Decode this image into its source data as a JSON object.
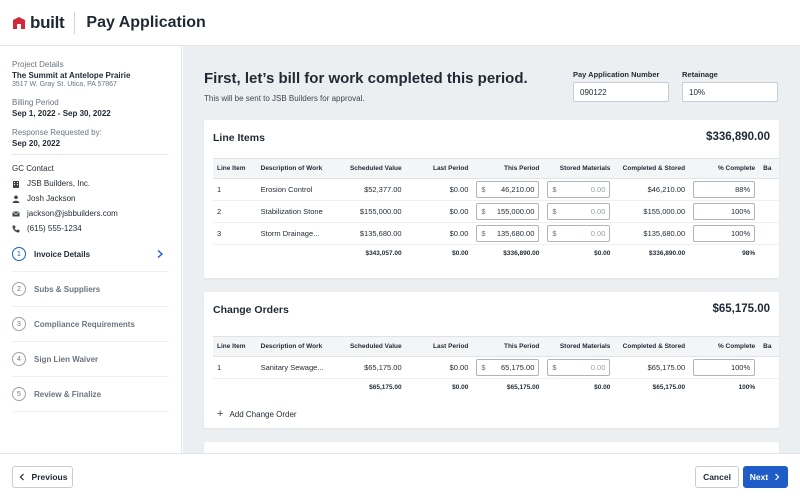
{
  "header": {
    "logo_text": "built",
    "title": "Pay Application"
  },
  "sidebar": {
    "project_label": "Project Details",
    "project_name": "The Summit at Antelope Prairie",
    "project_address": "3517 W. Gray St. Utica, PA 57867",
    "billing_label": "Billing Period",
    "billing_value": "Sep 1, 2022 - Sep 30, 2022",
    "response_label": "Response Requested by:",
    "response_value": "Sep 20, 2022",
    "gc_label": "GC Contact",
    "gc": {
      "company": "JSB Builders, Inc.",
      "name": "Josh Jackson",
      "email": "jackson@jsbbuilders.com",
      "phone": "(615) 555-1234"
    },
    "steps": [
      {
        "num": "1",
        "label": "Invoice Details"
      },
      {
        "num": "2",
        "label": "Subs & Suppliers"
      },
      {
        "num": "3",
        "label": "Compliance Requirements"
      },
      {
        "num": "4",
        "label": "Sign Lien Waiver"
      },
      {
        "num": "5",
        "label": "Review & Finalize"
      }
    ]
  },
  "main": {
    "headline": "First, let’s bill for work completed this period.",
    "subline": "This will be sent to JSB Builders for approval.",
    "pay_app_label": "Pay Application Number",
    "pay_app_value": "090122",
    "retainage_label": "Retainage",
    "retainage_value": "10%"
  },
  "columns": [
    "Line Item",
    "Description of Work",
    "Scheduled Value",
    "Last Period",
    "This Period",
    "Stored Materials",
    "Completed & Stored",
    "% Complete",
    "Ba"
  ],
  "line_items": {
    "title": "Line Items",
    "total": "$336,890.00",
    "rows": [
      {
        "item": "1",
        "desc": "Erosion Control",
        "scheduled": "$52,377.00",
        "last": "$0.00",
        "this_cur": "$",
        "this": "46,210.00",
        "stored_cur": "$",
        "stored": "0.00",
        "completed": "$46,210.00",
        "pct": "88%"
      },
      {
        "item": "2",
        "desc": "Stabilization Stone",
        "scheduled": "$155,000.00",
        "last": "$0.00",
        "this_cur": "$",
        "this": "155,000.00",
        "stored_cur": "$",
        "stored": "0.00",
        "completed": "$155,000.00",
        "pct": "100%"
      },
      {
        "item": "3",
        "desc": "Storm Drainage...",
        "scheduled": "$135,680.00",
        "last": "$0.00",
        "this_cur": "$",
        "this": "135,680.00",
        "stored_cur": "$",
        "stored": "0.00",
        "completed": "$135,680.00",
        "pct": "100%"
      }
    ],
    "totals": {
      "scheduled": "$343,057.00",
      "last": "$0.00",
      "this": "$336,890.00",
      "stored": "$0.00",
      "completed": "$336,890.00",
      "pct": "98%"
    }
  },
  "change_orders": {
    "title": "Change Orders",
    "total": "$65,175.00",
    "rows": [
      {
        "item": "1",
        "desc": "Sanitary Sewage...",
        "scheduled": "$65,175.00",
        "last": "$0.00",
        "this_cur": "$",
        "this": "65,175.00",
        "stored_cur": "$",
        "stored": "0.00",
        "completed": "$65,175.00",
        "pct": "100%"
      }
    ],
    "totals": {
      "scheduled": "$65,175.00",
      "last": "$0.00",
      "this": "$65,175.00",
      "stored": "$0.00",
      "completed": "$65,175.00",
      "pct": "100%"
    },
    "add_label": "Add Change Order"
  },
  "footer": {
    "previous": "Previous",
    "cancel": "Cancel",
    "next": "Next"
  },
  "colors": {
    "accent": "#1f5cc7",
    "logo_red": "#d3283a"
  },
  "icons": [
    "logo-icon",
    "building-icon",
    "person-icon",
    "mail-icon",
    "phone-icon",
    "chevron-right-icon",
    "chevron-left-icon",
    "plus-icon"
  ]
}
